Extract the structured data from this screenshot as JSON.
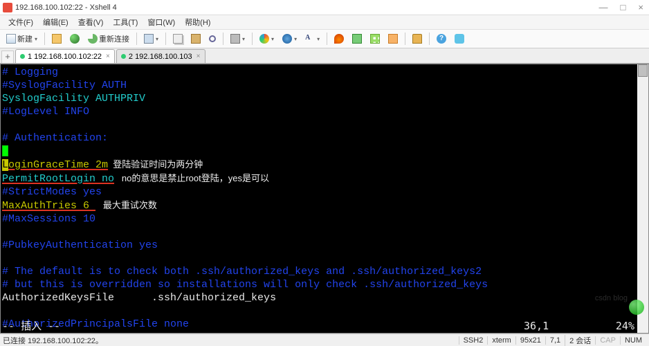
{
  "window": {
    "title": "192.168.100.102:22 - Xshell 4",
    "btn_min": "—",
    "btn_max": "□",
    "btn_close": "×"
  },
  "menu": {
    "file": "文件(F)",
    "edit": "编辑(E)",
    "view": "查看(V)",
    "tools": "工具(T)",
    "window": "窗口(W)",
    "help": "帮助(H)"
  },
  "toolbar": {
    "new": "新建",
    "reconnect": "重新连接"
  },
  "tabs": [
    {
      "label": "1 192.168.100.102:22",
      "active": true
    },
    {
      "label": "2 192.168.100.103",
      "active": false
    }
  ],
  "term": {
    "l1": "# Logging",
    "l2": "#SyslogFacility AUTH",
    "l3": "SyslogFacility AUTHPRIV",
    "l4": "#LogLevel INFO",
    "l5": "",
    "l6": "# Authentication:",
    "l7": "",
    "l8a": "L",
    "l8b": "oginG",
    "l8c": "raceTime 2m",
    "l8note": "  登陆验证时间为两分钟",
    "l9": "PermitRootLogin no",
    "l9note": "   no的意思是禁止root登陆，yes是可以",
    "l10": "#StrictModes yes",
    "l11": "MaxAuthTries 6 ",
    "l11note": "   最大重试次数",
    "l12": "#MaxSessions 10",
    "l13": "",
    "l14": "#PubkeyAuthentication yes",
    "l15": "",
    "l16": "# The default is to check both .ssh/authorized_keys and .ssh/authorized_keys2",
    "l17": "# but this is overridden so installations will only check .ssh/authorized_keys",
    "l18": "AuthorizedKeysFile      .ssh/authorized_keys",
    "l19": "",
    "l20": "#AuthorizedPrincipalsFile none",
    "vim_mode": "-- 插入 --",
    "vim_pos": "36,1",
    "vim_pct": "24%"
  },
  "status": {
    "conn": "已连接 192.168.100.102:22。",
    "proto": "SSH2",
    "term": "xterm",
    "size": "95x21",
    "enc": "7,1",
    "sess": "2 会话",
    "cap": "CAP",
    "num": "NUM"
  },
  "watermark": "csdn blog"
}
